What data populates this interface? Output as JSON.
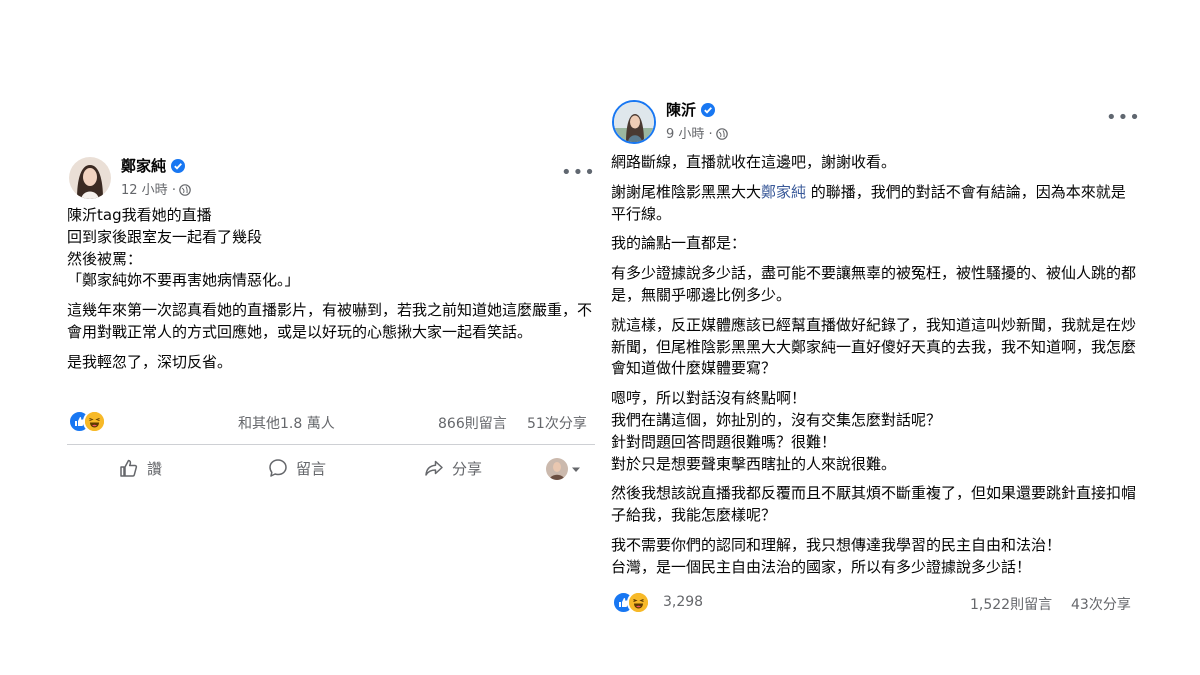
{
  "colors": {
    "accent": "#1877f2",
    "muted": "#65676b",
    "mention": "#385898",
    "haha": "#f7b928"
  },
  "left_post": {
    "author": "鄭家純",
    "time": "12 小時",
    "paragraphs": [
      "陳沂tag我看她的直播\n回到家後跟室友一起看了幾段\n然後被罵：\n「鄭家純妳不要再害她病情惡化。」",
      "這幾年來第一次認真看她的直播影片，有被嚇到，若我之前知道她這麼嚴重，不會用對戰正常人的方式回應她，或是以好玩的心態揪大家一起看笑話。",
      "是我輕忽了，深切反省。"
    ],
    "reaction_text": "和其他1.8 萬人",
    "comments": "866則留言",
    "shares": "51次分享",
    "actions": {
      "like": "讚",
      "comment": "留言",
      "share": "分享"
    },
    "icons": [
      "verified-icon",
      "globe-icon",
      "more-icon",
      "like-reaction-icon",
      "haha-reaction-icon",
      "thumbs-up-icon",
      "comment-icon",
      "share-icon",
      "chevron-down-icon"
    ]
  },
  "right_post": {
    "author": "陳沂",
    "time": "9 小時",
    "p1": "網路斷線，直播就收在這邊吧，謝謝收看。",
    "p2_before": "謝謝尾椎陰影黑黑大大",
    "p2_mention": "鄭家純",
    "p2_after": " 的聯播，我們的對話不會有結論，因為本來就是平行線。",
    "p3": "我的論點一直都是：",
    "p4": "有多少證據說多少話，盡可能不要讓無辜的被冤枉，被性騷擾的、被仙人跳的都是，無關乎哪邊比例多少。",
    "p5": "就這樣，反正媒體應該已經幫直播做好紀錄了，我知道這叫炒新聞，我就是在炒新聞，但尾椎陰影黑黑大大鄭家純一直好傻好天真的去我，我不知道啊，我怎麼會知道做什麼媒體要寫？",
    "p6": "嗯哼，所以對話沒有終點啊！\n我們在講這個，妳扯別的，沒有交集怎麼對話呢？\n針對問題回答問題很難嗎？很難！\n對於只是想要聲東擊西瞎扯的人來說很難。",
    "p7": "然後我想該說直播我都反覆而且不厭其煩不斷重複了，但如果還要跳針直接扣帽子給我，我能怎麼樣呢？",
    "p8": "我不需要你們的認同和理解，我只想傳達我學習的民主自由和法治！\n台灣，是一個民主自由法治的國家，所以有多少證據說多少話！",
    "reaction_count": "3,298",
    "comments": "1,522則留言",
    "shares": "43次分享"
  }
}
